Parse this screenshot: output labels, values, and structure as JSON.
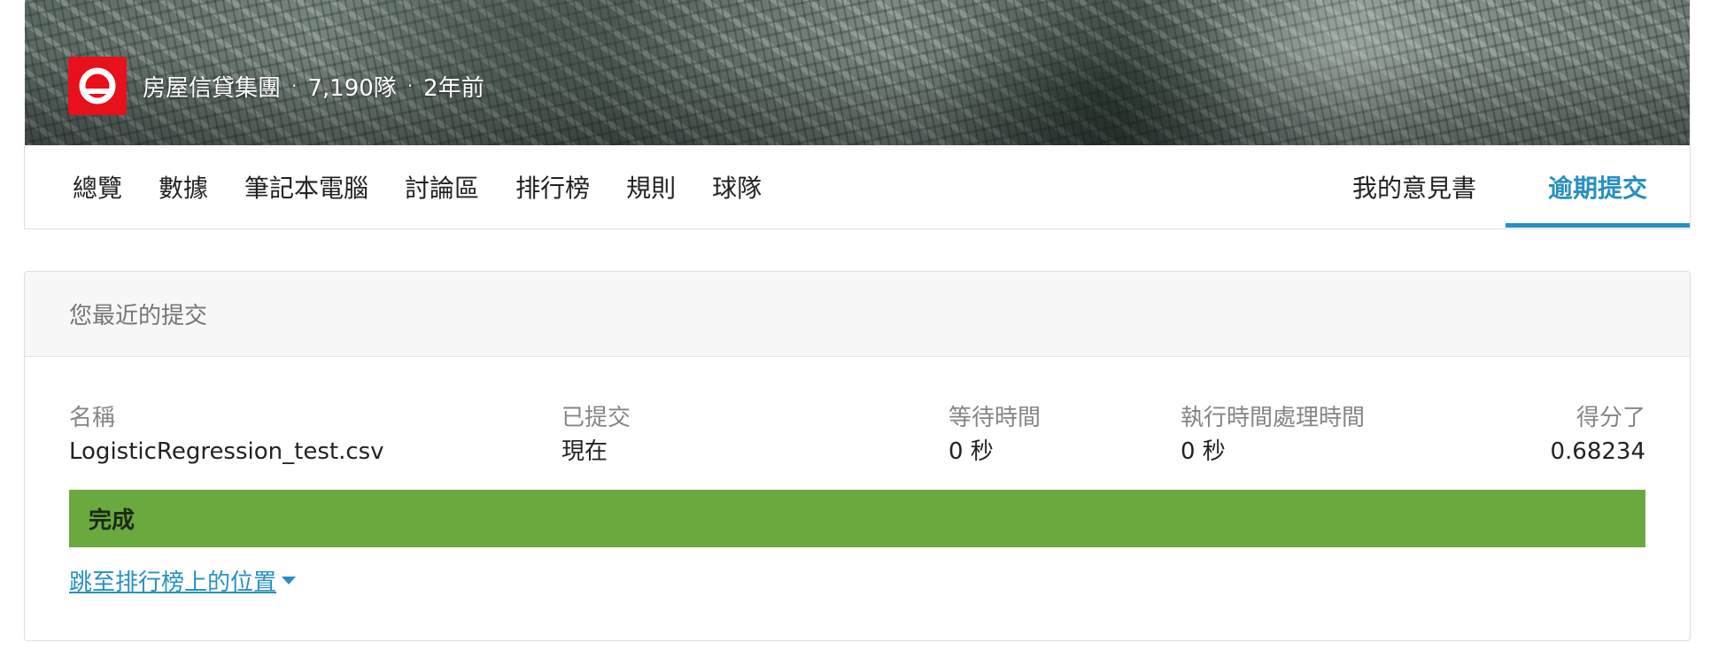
{
  "banner": {
    "org_name": "房屋信貸集團",
    "teams": "7,190隊",
    "time_ago": "2年前",
    "separator": "·"
  },
  "nav": {
    "left_tabs": [
      "總覽",
      "數據",
      "筆記本電腦",
      "討論區",
      "排行榜",
      "規則",
      "球隊"
    ],
    "right_tabs": [
      "我的意見書",
      "逾期提交"
    ],
    "active_tab": "逾期提交"
  },
  "submission": {
    "header": "您最近的提交",
    "columns": {
      "name_label": "名稱",
      "submitted_label": "已提交",
      "wait_label": "等待時間",
      "exec_label": "執行時間處理時間",
      "score_label": "得分了"
    },
    "row": {
      "name": "LogisticRegression_test.csv",
      "submitted": "現在",
      "wait": "0 秒",
      "exec": "0 秒",
      "score": "0.68234"
    },
    "status": "完成",
    "jump_link": "跳至排行榜上的位置"
  },
  "colors": {
    "accent": "#2790c1",
    "status_complete": "#6aa93e",
    "logo": "#e8101b"
  },
  "icons": {
    "org_logo": "home-credit-logo",
    "dropdown": "caret-down-icon"
  }
}
